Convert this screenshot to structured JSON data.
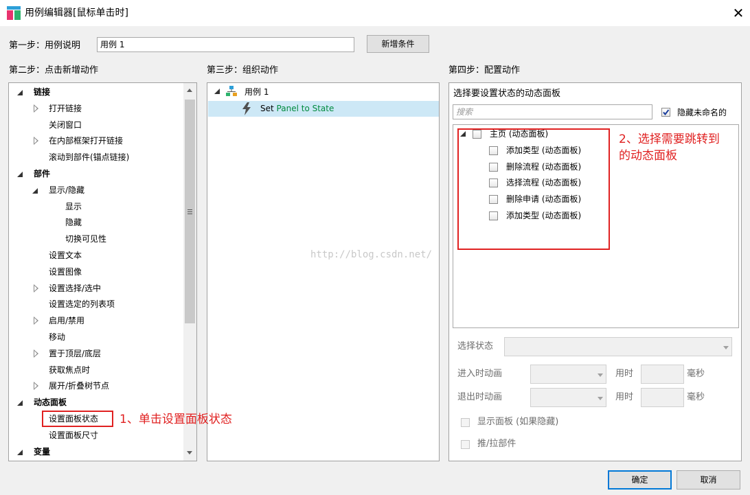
{
  "window": {
    "title": "用例编辑器[鼠标单击时]",
    "close_glyph": "✕"
  },
  "step1": {
    "label": "第一步：用例说明",
    "case_name": "用例 1",
    "add_condition": "新增条件"
  },
  "step2": {
    "label": "第二步：点击新增动作",
    "tree": [
      {
        "text": "链接",
        "bold": true,
        "level": 0,
        "arrow": "expanded"
      },
      {
        "text": "打开链接",
        "level": 1,
        "arrow": "collapsed"
      },
      {
        "text": "关闭窗口",
        "level": 1,
        "arrow": "none"
      },
      {
        "text": "在内部框架打开链接",
        "level": 1,
        "arrow": "collapsed"
      },
      {
        "text": "滚动到部件(锚点链接)",
        "level": 1,
        "arrow": "none"
      },
      {
        "text": "部件",
        "bold": true,
        "level": 0,
        "arrow": "expanded"
      },
      {
        "text": "显示/隐藏",
        "level": 1,
        "arrow": "expanded"
      },
      {
        "text": "显示",
        "level": 2,
        "arrow": "none"
      },
      {
        "text": "隐藏",
        "level": 2,
        "arrow": "none"
      },
      {
        "text": "切换可见性",
        "level": 2,
        "arrow": "none"
      },
      {
        "text": "设置文本",
        "level": 1,
        "arrow": "none"
      },
      {
        "text": "设置图像",
        "level": 1,
        "arrow": "none"
      },
      {
        "text": "设置选择/选中",
        "level": 1,
        "arrow": "collapsed"
      },
      {
        "text": "设置选定的列表项",
        "level": 1,
        "arrow": "none"
      },
      {
        "text": "启用/禁用",
        "level": 1,
        "arrow": "collapsed"
      },
      {
        "text": "移动",
        "level": 1,
        "arrow": "none"
      },
      {
        "text": "置于顶层/底层",
        "level": 1,
        "arrow": "collapsed"
      },
      {
        "text": "获取焦点时",
        "level": 1,
        "arrow": "none"
      },
      {
        "text": "展开/折叠树节点",
        "level": 1,
        "arrow": "collapsed"
      },
      {
        "text": "动态面板",
        "bold": true,
        "level": 0,
        "arrow": "expanded"
      },
      {
        "text": "设置面板状态",
        "level": 1,
        "arrow": "none",
        "highlight": true
      },
      {
        "text": "设置面板尺寸",
        "level": 1,
        "arrow": "none"
      },
      {
        "text": "变量",
        "bold": true,
        "level": 0,
        "arrow": "expanded"
      }
    ]
  },
  "step3": {
    "label": "第三步：组织动作",
    "case": "用例 1",
    "action_prefix": "Set",
    "action_target": "Panel to State"
  },
  "step4": {
    "label": "第四步：配置动作",
    "section_title": "选择要设置状态的动态面板",
    "search_placeholder": "搜索",
    "hide_unnamed": "隐藏未命名的",
    "panels": [
      {
        "text": "主页 (动态面板)",
        "level": 0
      },
      {
        "text": "添加类型 (动态面板)",
        "level": 1
      },
      {
        "text": "删除流程 (动态面板)",
        "level": 1
      },
      {
        "text": "选择流程 (动态面板)",
        "level": 1
      },
      {
        "text": "删除申请 (动态面板)",
        "level": 1
      },
      {
        "text": "添加类型 (动态面板)",
        "level": 1
      }
    ],
    "select_state": "选择状态",
    "enter_anim": "进入时动画",
    "exit_anim": "退出时动画",
    "duration": "用时",
    "ms": "毫秒",
    "show_panel": "显示面板 (如果隐藏)",
    "push_pull": "推/拉部件"
  },
  "annotations": {
    "a1": "1、单击设置面板状态",
    "a2_line1": "2、选择需要跳转到",
    "a2_line2": "的动态面板",
    "watermark": "http://blog.csdn.net/"
  },
  "footer": {
    "ok": "确定",
    "cancel": "取消"
  },
  "colors": {
    "accent_green": "#008a3e",
    "selected_bg": "#cde8f6",
    "annotation_red": "#e02020"
  }
}
